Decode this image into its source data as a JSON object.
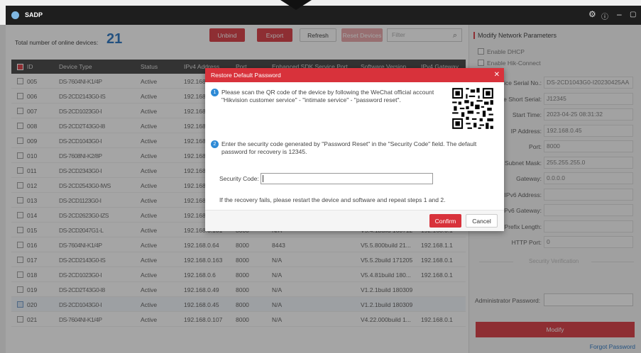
{
  "app": {
    "title": "SADP"
  },
  "toolbar": {
    "count_label": "Total number of online devices:",
    "count": "21",
    "unbind": "Unbind",
    "export": "Export",
    "refresh": "Refresh",
    "reset": "Reset Devices",
    "filter_placeholder": "Filter"
  },
  "table": {
    "headers": [
      "ID",
      "Device Type",
      "Status",
      "IPv4 Address",
      "Port",
      "Enhanced SDK Service Port",
      "Software Version",
      "IPv4 Gateway"
    ],
    "rows": [
      {
        "id": "005",
        "type": "DS-7604NI-K1/4P",
        "status": "Active",
        "ip": "192.168.0.63",
        "port": "",
        "sdk": "",
        "ver": "",
        "gw": "",
        "checked": false
      },
      {
        "id": "006",
        "type": "DS-2CD2143G0-IS",
        "status": "Active",
        "ip": "192.168.0.64",
        "port": "",
        "sdk": "",
        "ver": "",
        "gw": "",
        "checked": false
      },
      {
        "id": "007",
        "type": "DS-2CD1023G0-I",
        "status": "Active",
        "ip": "192.168.0.65",
        "port": "",
        "sdk": "",
        "ver": "",
        "gw": "",
        "checked": false
      },
      {
        "id": "008",
        "type": "DS-2CD2T43G0-I8",
        "status": "Active",
        "ip": "192.168.0.66",
        "port": "",
        "sdk": "",
        "ver": "",
        "gw": "",
        "checked": false
      },
      {
        "id": "009",
        "type": "DS-2CD1043G0-I",
        "status": "Active",
        "ip": "192.168.0.67",
        "port": "",
        "sdk": "",
        "ver": "",
        "gw": "",
        "checked": false
      },
      {
        "id": "010",
        "type": "DS-7608NI-K2/8P",
        "status": "Active",
        "ip": "192.168.0.68",
        "port": "",
        "sdk": "",
        "ver": "",
        "gw": "",
        "checked": false
      },
      {
        "id": "011",
        "type": "DS-2CD2343G0-I",
        "status": "Active",
        "ip": "192.168.0.69",
        "port": "",
        "sdk": "",
        "ver": "",
        "gw": "",
        "checked": false
      },
      {
        "id": "012",
        "type": "DS-2CD2543G0-IWS",
        "status": "Active",
        "ip": "192.168.0.70",
        "port": "",
        "sdk": "",
        "ver": "",
        "gw": "",
        "checked": false
      },
      {
        "id": "013",
        "type": "DS-2CD1123G0-I",
        "status": "Active",
        "ip": "192.168.0.71",
        "port": "",
        "sdk": "",
        "ver": "",
        "gw": "",
        "checked": false
      },
      {
        "id": "014",
        "type": "DS-2CD2623G0-IZS",
        "status": "Active",
        "ip": "192.168.0.72",
        "port": "",
        "sdk": "",
        "ver": "",
        "gw": "",
        "checked": false
      },
      {
        "id": "015",
        "type": "DS-2CD2047G1-L",
        "status": "Active",
        "ip": "192.168.0.101",
        "port": "8000",
        "sdk": "N/A",
        "ver": "V5.4.1build 160712",
        "gw": "192.168.0.1",
        "checked": false
      },
      {
        "id": "016",
        "type": "DS-7604NI-K1/4P",
        "status": "Active",
        "ip": "192.168.0.64",
        "port": "8000",
        "sdk": "8443",
        "ver": "V5.5.800build 21...",
        "gw": "192.168.1.1",
        "checked": false
      },
      {
        "id": "017",
        "type": "DS-2CD2143G0-IS",
        "status": "Active",
        "ip": "192.168.0.163",
        "port": "8000",
        "sdk": "N/A",
        "ver": "V5.5.2build 171205",
        "gw": "192.168.0.1",
        "checked": false
      },
      {
        "id": "018",
        "type": "DS-2CD1023G0-I",
        "status": "Active",
        "ip": "192.168.0.6",
        "port": "8000",
        "sdk": "N/A",
        "ver": "V5.4.81build 180...",
        "gw": "192.168.0.1",
        "checked": false
      },
      {
        "id": "019",
        "type": "DS-2CD2T43G0-I8",
        "status": "Active",
        "ip": "192.168.0.49",
        "port": "8000",
        "sdk": "N/A",
        "ver": "V1.2.1build 180309",
        "gw": "",
        "checked": false
      },
      {
        "id": "020",
        "type": "DS-2CD1043G0-I",
        "status": "Active",
        "ip": "192.168.0.45",
        "port": "8000",
        "sdk": "N/A",
        "ver": "V1.2.1build 180309",
        "gw": "",
        "checked": true
      },
      {
        "id": "021",
        "type": "DS-7604NI-K1/4P",
        "status": "Active",
        "ip": "192.168.0.107",
        "port": "8000",
        "sdk": "N/A",
        "ver": "V4.22.000build 1...",
        "gw": "192.168.0.1",
        "checked": false
      }
    ]
  },
  "panel": {
    "title": "Modify Network Parameters",
    "enable_dhcp": "Enable DHCP",
    "enable_hik": "Enable Hik-Connect",
    "fields": [
      {
        "label": "Device Serial No.:",
        "value": "DS-2CD1043G0-I20230425AA"
      },
      {
        "label": "Device Short Serial:",
        "value": "J12345"
      },
      {
        "label": "Start Time:",
        "value": "2023-04-25 08:31:32"
      },
      {
        "label": "IP Address:",
        "value": "192.168.0.45"
      },
      {
        "label": "Port:",
        "value": "8000"
      },
      {
        "label": "Subnet Mask:",
        "value": "255.255.255.0"
      },
      {
        "label": "Gateway:",
        "value": "0.0.0.0"
      },
      {
        "label": "IPv6 Address:",
        "value": ""
      },
      {
        "label": "IPv6 Gateway:",
        "value": ""
      },
      {
        "label": "IPv6 Prefix Length:",
        "value": ""
      },
      {
        "label": "HTTP Port:",
        "value": "0"
      }
    ],
    "security": "Security Verification",
    "admin_label": "Administrator Password:",
    "modify": "Modify",
    "forgot": "Forgot Password"
  },
  "dialog": {
    "title": "Restore Default Password",
    "step1": "Please scan the QR code of the device by following the WeChat official account \"Hikvision customer service\" - \"intimate service\" - \"password reset\".",
    "step2": "Enter the security code generated by \"Password Reset\" in the \"Security Code\" field. The default password for recovery is 12345.",
    "sc_label": "Security Code:",
    "note": "If the recovery fails, please restart the device and software and repeat steps 1 and 2.",
    "confirm": "Confirm",
    "cancel": "Cancel",
    "step1_num": "1",
    "step2_num": "2"
  },
  "colors": {
    "accent": "#d8323b",
    "count": "#1f6fbf",
    "step": "#2d8ad6"
  },
  "icons": {
    "settings": "gear-icon",
    "info": "info-icon",
    "minimize": "minimize-icon",
    "maximize": "maximize-icon",
    "close": "close-icon",
    "search": "search-icon"
  }
}
